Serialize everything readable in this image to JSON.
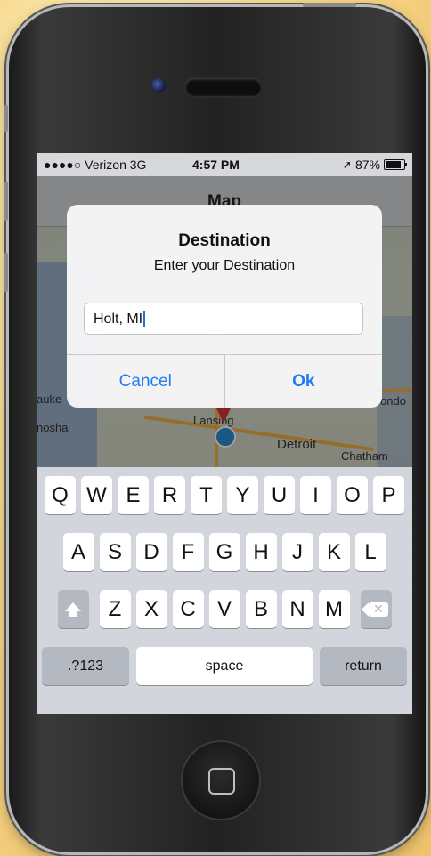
{
  "statusbar": {
    "carrier": "●●●●○ Verizon  3G",
    "time": "4:57 PM",
    "battery": "87%",
    "location_icon": "location-arrow-icon",
    "battery_level": 0.87
  },
  "nav": {
    "title": "Map"
  },
  "map": {
    "labels": [
      "auke",
      "nosha",
      "Lansing",
      "Detroit",
      "Chatham",
      "ondo"
    ]
  },
  "alert": {
    "title": "Destination",
    "message": "Enter your Destination",
    "input_value": "Holt, MI",
    "cancel_label": "Cancel",
    "ok_label": "Ok"
  },
  "keyboard": {
    "row1": [
      "Q",
      "W",
      "E",
      "R",
      "T",
      "Y",
      "U",
      "I",
      "O",
      "P"
    ],
    "row2": [
      "A",
      "S",
      "D",
      "F",
      "G",
      "H",
      "J",
      "K",
      "L"
    ],
    "row3": [
      "Z",
      "X",
      "C",
      "V",
      "B",
      "N",
      "M"
    ],
    "numbers_label": ".?123",
    "space_label": "space",
    "return_label": "return"
  }
}
